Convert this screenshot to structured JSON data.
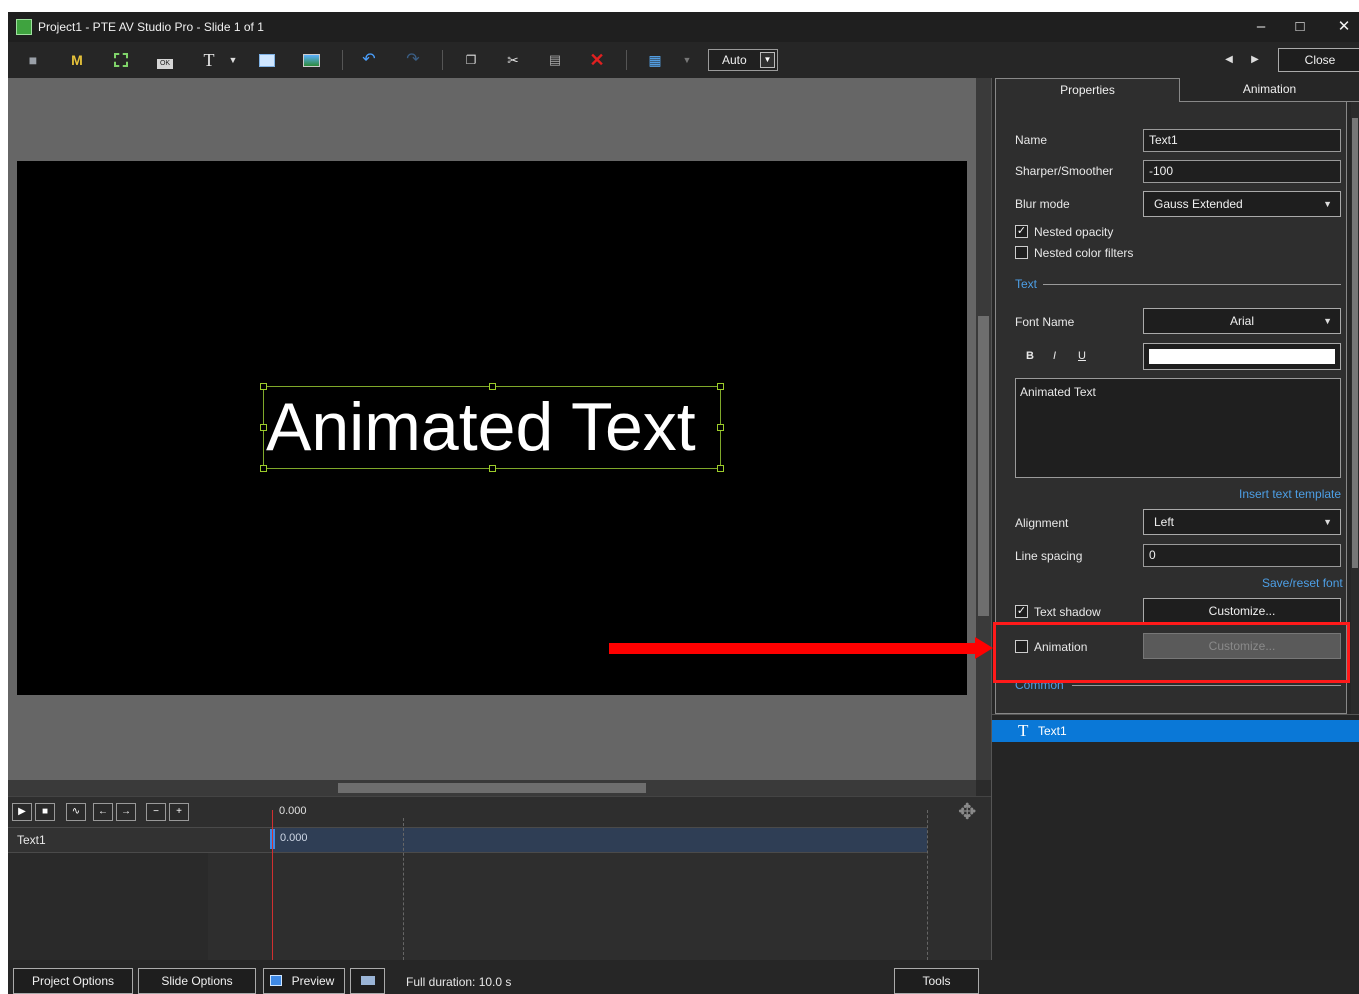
{
  "window": {
    "title": "Project1 - PTE AV Studio Pro - Slide 1 of 1",
    "minimize": "–",
    "maximize": "□",
    "close": "✕"
  },
  "toolbar": {
    "auto_label": "Auto",
    "close_label": "Close",
    "icons": [
      "camera-icon",
      "mask-icon",
      "frame-icon",
      "button-object-icon",
      "text-tool-icon",
      "rectangle-icon",
      "image-icon",
      "undo-icon",
      "redo-icon",
      "copy-icon",
      "cut-icon",
      "paste-icon",
      "delete-icon",
      "grid-icon",
      "prev-arrow-icon",
      "next-arrow-icon"
    ]
  },
  "canvas": {
    "text": "Animated Text"
  },
  "timeline": {
    "time_header": "0.000",
    "row_label": "Text1",
    "row_time": "0.000"
  },
  "statusbar": {
    "project_options": "Project Options",
    "slide_options": "Slide Options",
    "preview": "Preview",
    "full_duration": "Full duration: 10.0 s",
    "tools": "Tools"
  },
  "panel": {
    "tab_properties": "Properties",
    "tab_animation": "Animation",
    "name_label": "Name",
    "name_value": "Text1",
    "sharper_label": "Sharper/Smoother",
    "sharper_value": "-100",
    "blur_label": "Blur mode",
    "blur_value": "Gauss Extended",
    "nested_opacity": "Nested opacity",
    "nested_opacity_checked": true,
    "nested_color_filters": "Nested color filters",
    "nested_color_filters_checked": false,
    "text_section": "Text",
    "font_name_label": "Font Name",
    "font_name_value": "Arial",
    "bold": "B",
    "italic": "I",
    "underline": "U",
    "text_color": "#ffffff",
    "text_value": "Animated Text",
    "insert_template": "Insert text template",
    "alignment_label": "Alignment",
    "alignment_value": "Left",
    "line_spacing_label": "Line spacing",
    "line_spacing_value": "0",
    "save_reset_font": "Save/reset font",
    "text_shadow": "Text shadow",
    "text_shadow_checked": true,
    "customize": "Customize...",
    "animation": "Animation",
    "animation_checked": false,
    "animation_customize": "Customize...",
    "common_section": "Common"
  },
  "objects": {
    "items": [
      {
        "label": "Text1",
        "selected": true
      }
    ]
  },
  "colors": {
    "accent": "#4d9fe6",
    "selection": "#0a78d7",
    "annotation": "#ff0000"
  }
}
